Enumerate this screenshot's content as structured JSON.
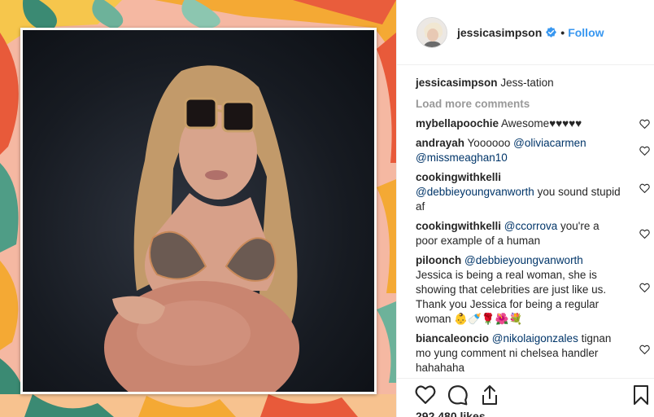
{
  "post": {
    "username": "jessicasimpson",
    "follow_label": "Follow",
    "separator": "•"
  },
  "caption": {
    "username": "jessicasimpson",
    "text": "Jess-tation"
  },
  "load_more": "Load more comments",
  "comments": [
    {
      "user": "mybellapoochie",
      "text": "Awesome♥♥♥♥♥",
      "mention": ""
    },
    {
      "user": "andrayah",
      "text": "Yoooooo",
      "mention": "@oliviacarmen @missmeaghan10"
    },
    {
      "user": "cookingwithkelli",
      "text": "you sound stupid af",
      "mention": "@debbieyoungvanworth"
    },
    {
      "user": "cookingwithkelli",
      "text": "you're a poor example of a human",
      "mention": "@ccorrova"
    },
    {
      "user": "piloonch",
      "text": "Jessica is being a real woman, she is showing that celebrities are just like us. Thank you Jessica for being a regular woman 👶🍼🌹🌺💐",
      "mention": "@debbieyoungvanworth"
    },
    {
      "user": "biancaleoncio",
      "text": "tignan mo yung comment ni chelsea handler hahahaha",
      "mention": "@nikolaigonzales"
    }
  ],
  "likes": "292,480 likes",
  "icons": {
    "verified": "verified-badge-icon",
    "like": "heart-icon",
    "comment": "comment-bubble-icon",
    "share": "share-icon",
    "save": "bookmark-icon"
  },
  "colors": {
    "link_blue": "#3897f0",
    "mention_blue": "#003569",
    "muted_gray": "#999999"
  }
}
